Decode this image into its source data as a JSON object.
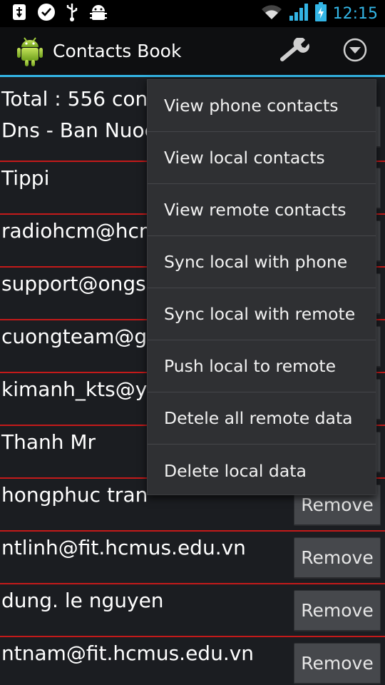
{
  "status_bar": {
    "time": "12:15",
    "icons": [
      "usb-debug-icon",
      "chat-icon",
      "usb-icon",
      "android-debug-icon",
      "wifi-icon",
      "signal-icon",
      "battery-charging-icon"
    ]
  },
  "action_bar": {
    "title": "Contacts Book",
    "icons": [
      "app-logo-icon",
      "wrench-icon",
      "overflow-menu-icon"
    ]
  },
  "list": {
    "total_line": "Total : 556 contacts",
    "subtitle_line": "Dns - Ban Nuoc",
    "rows": [
      {
        "name": "Tippi"
      },
      {
        "name": "radiohcm@hcm.vnn.vn"
      },
      {
        "name": "support@ongsoft.com"
      },
      {
        "name": "cuongteam@gmail.com"
      },
      {
        "name": "kimanh_kts@yahoo.com"
      },
      {
        "name": "Thanh Mr"
      },
      {
        "name": "hongphuc tran"
      },
      {
        "name": "ntlinh@fit.hcmus.edu.vn"
      },
      {
        "name": "dung. le nguyen"
      },
      {
        "name": "ntnam@fit.hcmus.edu.vn"
      }
    ],
    "remove_label": "Remove"
  },
  "menu": {
    "items": [
      "View phone contacts",
      "View local contacts",
      "View remote contacts",
      "Sync local with phone",
      "Sync local with remote",
      "Push local to remote",
      "Detele all remote data",
      "Delete local data"
    ]
  },
  "colors": {
    "accent": "#33b5e5",
    "divider": "#c41a1a",
    "background": "#1b1d21",
    "menu_bg": "#2f3033"
  }
}
